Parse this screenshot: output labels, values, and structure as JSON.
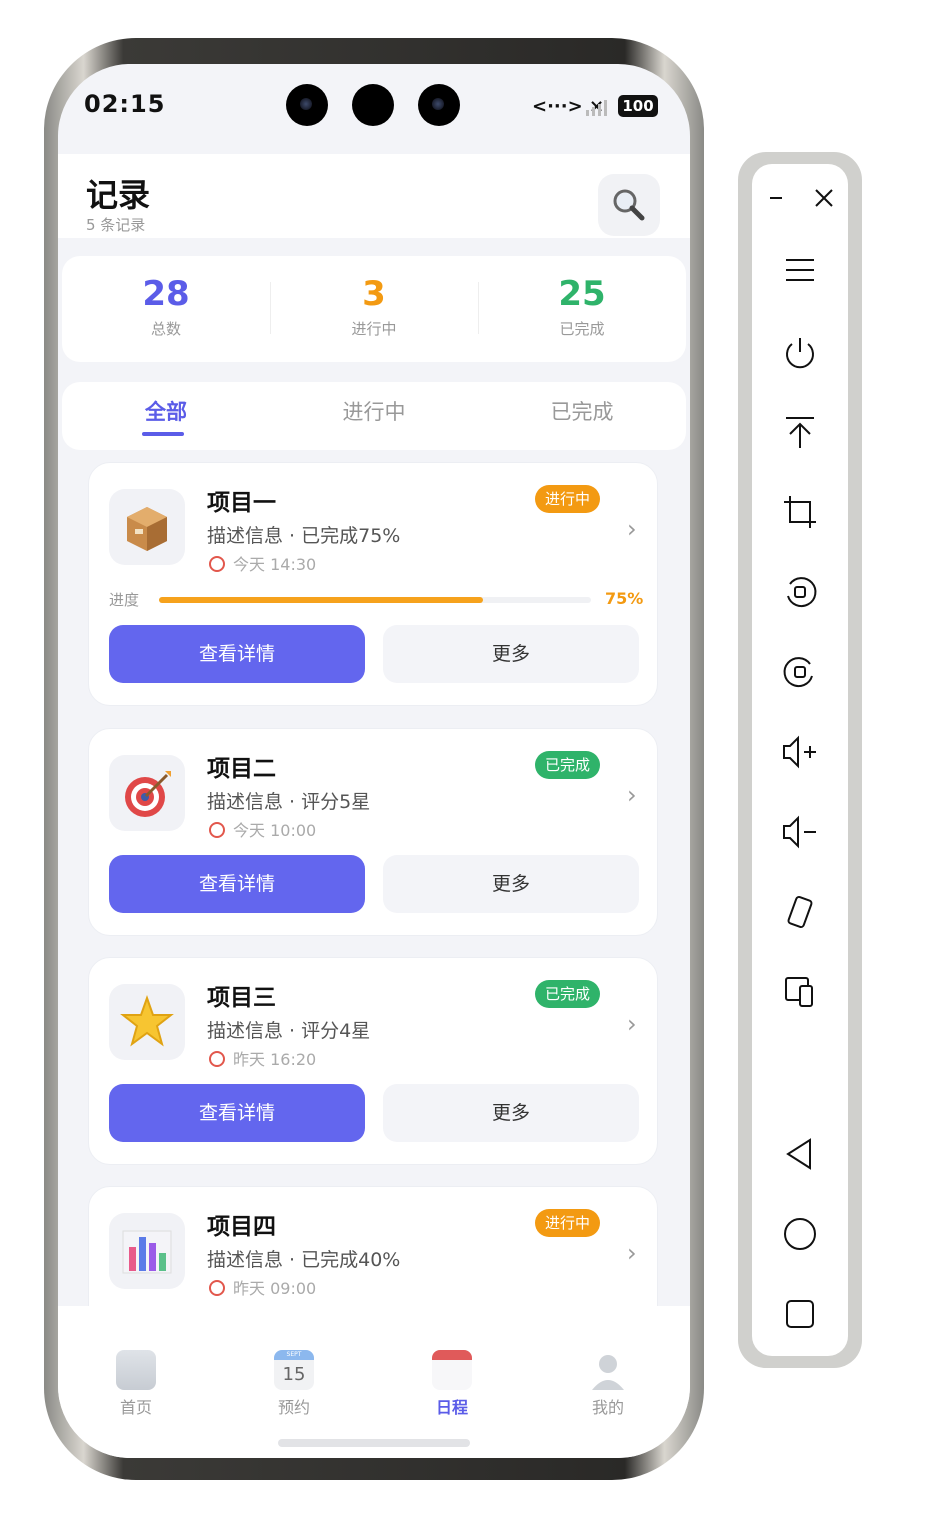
{
  "status_bar": {
    "time": "02:15",
    "signal": "<···> ×",
    "battery": "100"
  },
  "header": {
    "title": "记录",
    "subtitle": "5 条记录",
    "search_icon": "search-icon"
  },
  "stats": [
    {
      "value": "28",
      "label": "总数",
      "color": "#5b5ce8"
    },
    {
      "value": "3",
      "label": "进行中",
      "color": "#f39a12"
    },
    {
      "value": "25",
      "label": "已完成",
      "color": "#2fb36a"
    }
  ],
  "tabs": [
    {
      "label": "全部",
      "active": true
    },
    {
      "label": "进行中",
      "active": false
    },
    {
      "label": "已完成",
      "active": false
    }
  ],
  "cards": [
    {
      "title": "项目一",
      "desc": "描述信息 · 已完成75%",
      "time": "今天 14:30",
      "badge": "进行中",
      "badge_color": "#f39a12",
      "icon": "package-icon",
      "progress_label": "进度",
      "progress": 0.75,
      "progress_text": "75%",
      "primary_btn": "查看详情",
      "secondary_btn": "更多"
    },
    {
      "title": "项目二",
      "desc": "描述信息 · 评分5星",
      "time": "今天 10:00",
      "badge": "已完成",
      "badge_color": "#2fb36a",
      "icon": "target-icon",
      "primary_btn": "查看详情",
      "secondary_btn": "更多"
    },
    {
      "title": "项目三",
      "desc": "描述信息 · 评分4星",
      "time": "昨天 16:20",
      "badge": "已完成",
      "badge_color": "#2fb36a",
      "icon": "star-icon",
      "primary_btn": "查看详情",
      "secondary_btn": "更多"
    },
    {
      "title": "项目四",
      "desc": "描述信息 · 已完成40%",
      "time": "昨天 09:00",
      "badge": "进行中",
      "badge_color": "#f39a12",
      "icon": "bar-chart-icon"
    }
  ],
  "bottom_nav": [
    {
      "label": "首页",
      "icon": "building-icon",
      "active": false
    },
    {
      "label": "预约",
      "icon": "calendar-icon",
      "active": false,
      "icon_day": "15",
      "icon_month": "SEPT"
    },
    {
      "label": "日程",
      "icon": "spiral-calendar-icon",
      "active": true
    },
    {
      "label": "我的",
      "icon": "user-icon",
      "active": false
    }
  ],
  "toolbar": [
    "minimize-icon",
    "close-icon",
    "menu-icon",
    "power-icon",
    "pin-top-icon",
    "crop-icon",
    "rotate-left-icon",
    "rotate-right-icon",
    "volume-up-icon",
    "volume-down-icon",
    "rotate-device-icon",
    "devices-icon",
    "back-icon",
    "home-icon",
    "recents-icon"
  ],
  "accent_color": "#5b5ce8"
}
